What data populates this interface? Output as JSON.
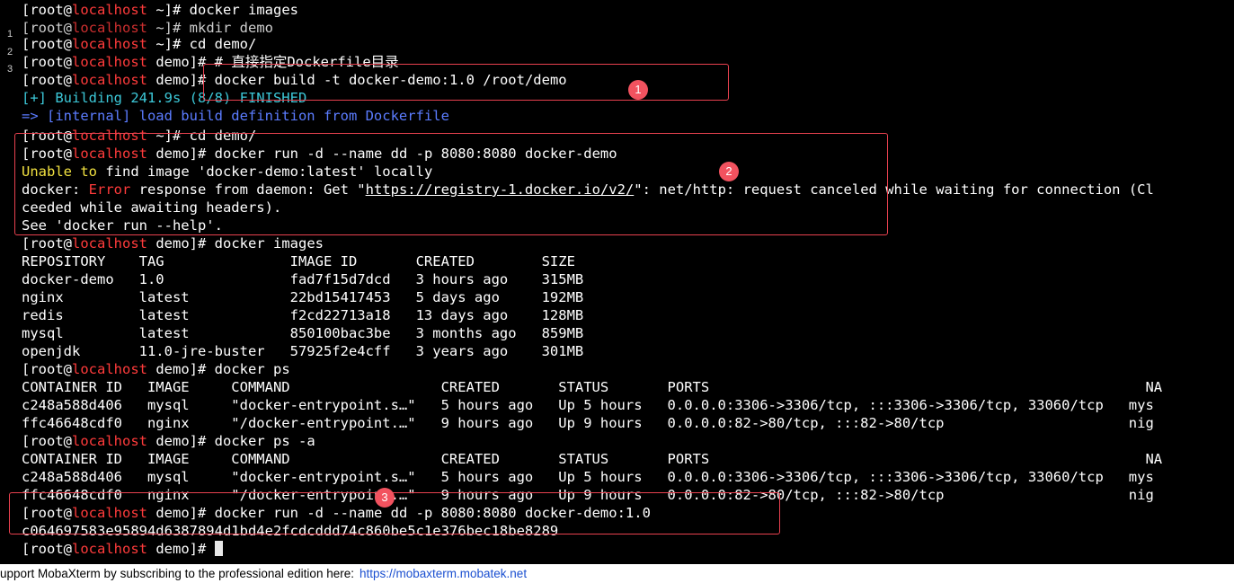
{
  "terminal": {
    "prompt_user": "[root@",
    "prompt_host": "localhost",
    "lines": [
      {
        "id": "l00",
        "top": "~]# ",
        "cmd": "docker images"
      },
      {
        "id": "l01",
        "top": "~]# ",
        "cmd": "mkdir demo"
      },
      {
        "id": "l02",
        "top": "~]# ",
        "cmd": "cd demo/"
      },
      {
        "id": "l03",
        "top": "demo]# ",
        "cmd": "# 直接指定Dockerfile目录"
      },
      {
        "id": "l04",
        "top": "demo]# ",
        "cmd": "docker build -t docker-demo:1.0 /root/demo"
      }
    ],
    "build_status": "[+] Building 241.9s (8/8) FINISHED",
    "build_step": "=> [internal] load build definition from Dockerfile",
    "l07_prompt": "~]# ",
    "l07_cmd": "cd demo/",
    "l08_prompt": "demo]# ",
    "l08_cmd": "docker run -d --name dd -p 8080:8080 docker-demo",
    "l09_word1": "Unable",
    "l09_word2": " to",
    "l09_rest": " find image 'docker-demo:latest' locally",
    "l10_a": "docker: ",
    "l10_err": "Error",
    "l10_b": " response from daemon: Get \"",
    "l10_url": "https://registry-1.docker.io/v2/",
    "l10_c": "\": net/http: request canceled while waiting for connection (Cl",
    "l11": "ceeded while awaiting headers).",
    "l12": "See 'docker run --help'.",
    "l13_prompt": "demo]# ",
    "l13_cmd": "docker images",
    "images_header": "REPOSITORY    TAG               IMAGE ID       CREATED        SIZE",
    "images_rows": [
      "docker-demo   1.0               fad7f15d7dcd   3 hours ago    315MB",
      "nginx         latest            22bd15417453   5 days ago     192MB",
      "redis         latest            f2cd22713a18   13 days ago    128MB",
      "mysql         latest            850100bac3be   3 months ago   859MB",
      "openjdk       11.0-jre-buster   57925f2e4cff   3 years ago    301MB"
    ],
    "l19_prompt": "demo]# ",
    "l19_cmd": "docker ps",
    "ps_header": "CONTAINER ID   IMAGE     COMMAND                  CREATED       STATUS       PORTS                                                    NA",
    "ps_rows": [
      "c248a588d406   mysql     \"docker-entrypoint.s…\"   5 hours ago   Up 5 hours   0.0.0.0:3306->3306/tcp, :::3306->3306/tcp, 33060/tcp   mys",
      "ffc46648cdf0   nginx     \"/docker-entrypoint.…\"   9 hours ago   Up 9 hours   0.0.0.0:82->80/tcp, :::82->80/tcp                      nig"
    ],
    "l23_prompt": "demo]# ",
    "l23_cmd": "docker ps -a",
    "l27_prompt": "demo]# ",
    "l27_cmd": "docker run -d --name dd -p 8080:8080 docker-demo:1.0",
    "container_hash": "c064697583e95894d6387894d1bd4e2fcdcddd74c860be5c1e376bec18be8289",
    "l29_prompt": "demo]# "
  },
  "gutter": [
    "1",
    "2",
    "3"
  ],
  "callouts": [
    "1",
    "2",
    "3"
  ],
  "footer": {
    "text": "upport MobaXterm by subscribing to the professional edition here:",
    "link": "https://mobaxterm.mobatek.net"
  }
}
